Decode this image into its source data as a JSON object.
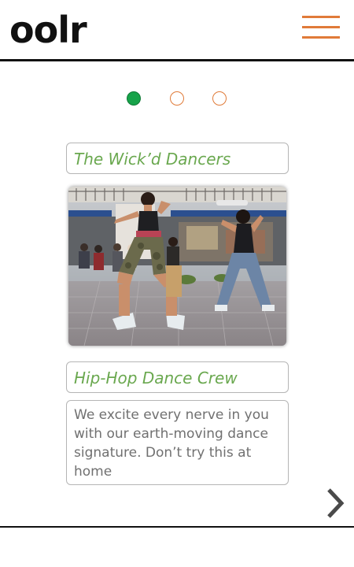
{
  "app": {
    "logo": "oolr"
  },
  "colors": {
    "accent": "#e07b39",
    "active_dot": "#17a34a",
    "title_green": "#6aa84f"
  },
  "carousel": {
    "slide_count": 3,
    "active_index": 0
  },
  "slide": {
    "title": "The Wick’d Dancers",
    "image_icon": "dance-photo",
    "subtitle": "Hip-Hop Dance Crew",
    "description": "We excite every nerve in you with our earth-moving dance signature. Don’t try this at home"
  },
  "nav": {
    "menu_icon": "hamburger-menu-icon",
    "next_icon": "chevron-right-icon"
  }
}
